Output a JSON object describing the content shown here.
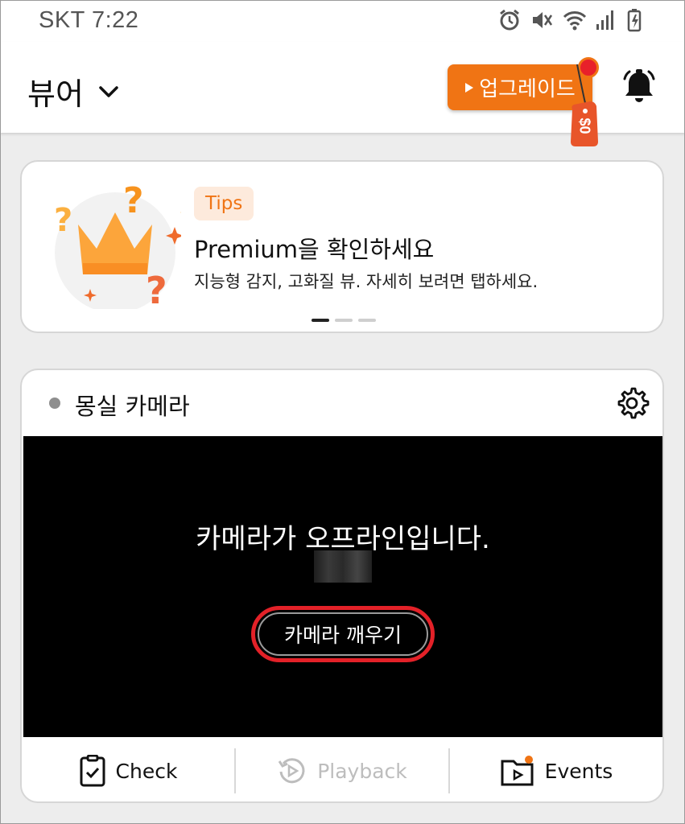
{
  "status_bar": {
    "carrier": "SKT",
    "time": "7:22",
    "icons": [
      "alarm-icon",
      "vibrate-mute-icon",
      "wifi-icon",
      "signal-icon",
      "battery-charging-icon"
    ]
  },
  "header": {
    "title": "뷰어",
    "upgrade_label": "업그레이드",
    "price_tag": "$0"
  },
  "tips": {
    "badge": "Tips",
    "title": "Premium을 확인하세요",
    "description": "지능형 감지, 고화질 뷰. 자세히 보려면 탭하세요.",
    "page_count": 3,
    "active_page": 1
  },
  "camera": {
    "name": "몽실 카메라",
    "status_color": "#8e8e8e",
    "offline_message": "카메라가 오프라인입니다.",
    "wake_button": "카메라 깨우기",
    "actions": [
      {
        "label": "Check",
        "enabled": true
      },
      {
        "label": "Playback",
        "enabled": false
      },
      {
        "label": "Events",
        "enabled": true
      }
    ]
  },
  "colors": {
    "accent": "#f07414",
    "alert_red": "#e8202a",
    "highlight_ring": "#e32128"
  }
}
